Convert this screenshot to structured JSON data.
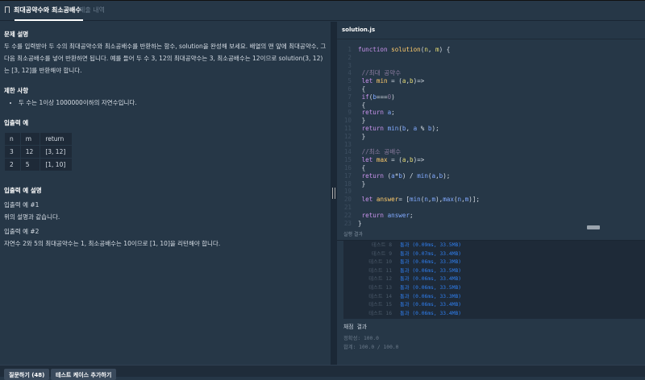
{
  "tabs": {
    "active": "최대공약수와 최소공배수",
    "inactive": "제출 내역"
  },
  "problem": {
    "desc_title": "문제 설명",
    "desc": "두 수를 입력받아 두 수의 최대공약수와 최소공배수를 반환하는 함수, solution을 완성해 보세요. 배열의 맨 앞에 최대공약수, 그다음 최소공배수를 넣어 반환하면 됩니다. 예를 들어 두 수 3, 12의 최대공약수는 3, 최소공배수는 12이므로 solution(3, 12)는 [3, 12]를 반환해야 합니다.",
    "limit_title": "제한 사항",
    "limits": [
      "두 수는 1이상 1000000이하의 자연수입니다."
    ],
    "example_title": "입출력 예",
    "table": {
      "headers": [
        "n",
        "m",
        "return"
      ],
      "rows": [
        [
          "3",
          "12",
          "[3, 12]"
        ],
        [
          "2",
          "5",
          "[1, 10]"
        ]
      ]
    },
    "explain_title": "입출력 예 설명",
    "ex1_title": "입출력 예 #1",
    "ex1": "위의 설명과 같습니다.",
    "ex2_title": "입출력 예 #2",
    "ex2": "자연수 2와 5의 최대공약수는 1, 최소공배수는 10이므로 [1, 10]을 리턴해야 합니다."
  },
  "editor": {
    "filename": "solution.js"
  },
  "results": {
    "title": "실행 결과",
    "tests": [
      {
        "label": "테스트 8",
        "result": "통과 (0.09ms, 33.5MB)"
      },
      {
        "label": "테스트 9",
        "result": "통과 (0.07ms, 33.4MB)"
      },
      {
        "label": "테스트 10",
        "result": "통과 (0.06ms, 33.3MB)"
      },
      {
        "label": "테스트 11",
        "result": "통과 (0.06ms, 33.5MB)"
      },
      {
        "label": "테스트 12",
        "result": "통과 (0.06ms, 33.4MB)"
      },
      {
        "label": "테스트 13",
        "result": "통과 (0.06ms, 33.5MB)"
      },
      {
        "label": "테스트 14",
        "result": "통과 (0.06ms, 33.3MB)"
      },
      {
        "label": "테스트 15",
        "result": "통과 (0.06ms, 33.4MB)"
      },
      {
        "label": "테스트 16",
        "result": "통과 (0.06ms, 33.4MB)"
      }
    ],
    "grade_title": "채점 결과",
    "accuracy": "정확성: 100.0",
    "total": "합계: 100.0 / 100.0"
  },
  "buttons": {
    "question": "질문하기 (48)",
    "add_test": "테스트 케이스 추가하기"
  }
}
